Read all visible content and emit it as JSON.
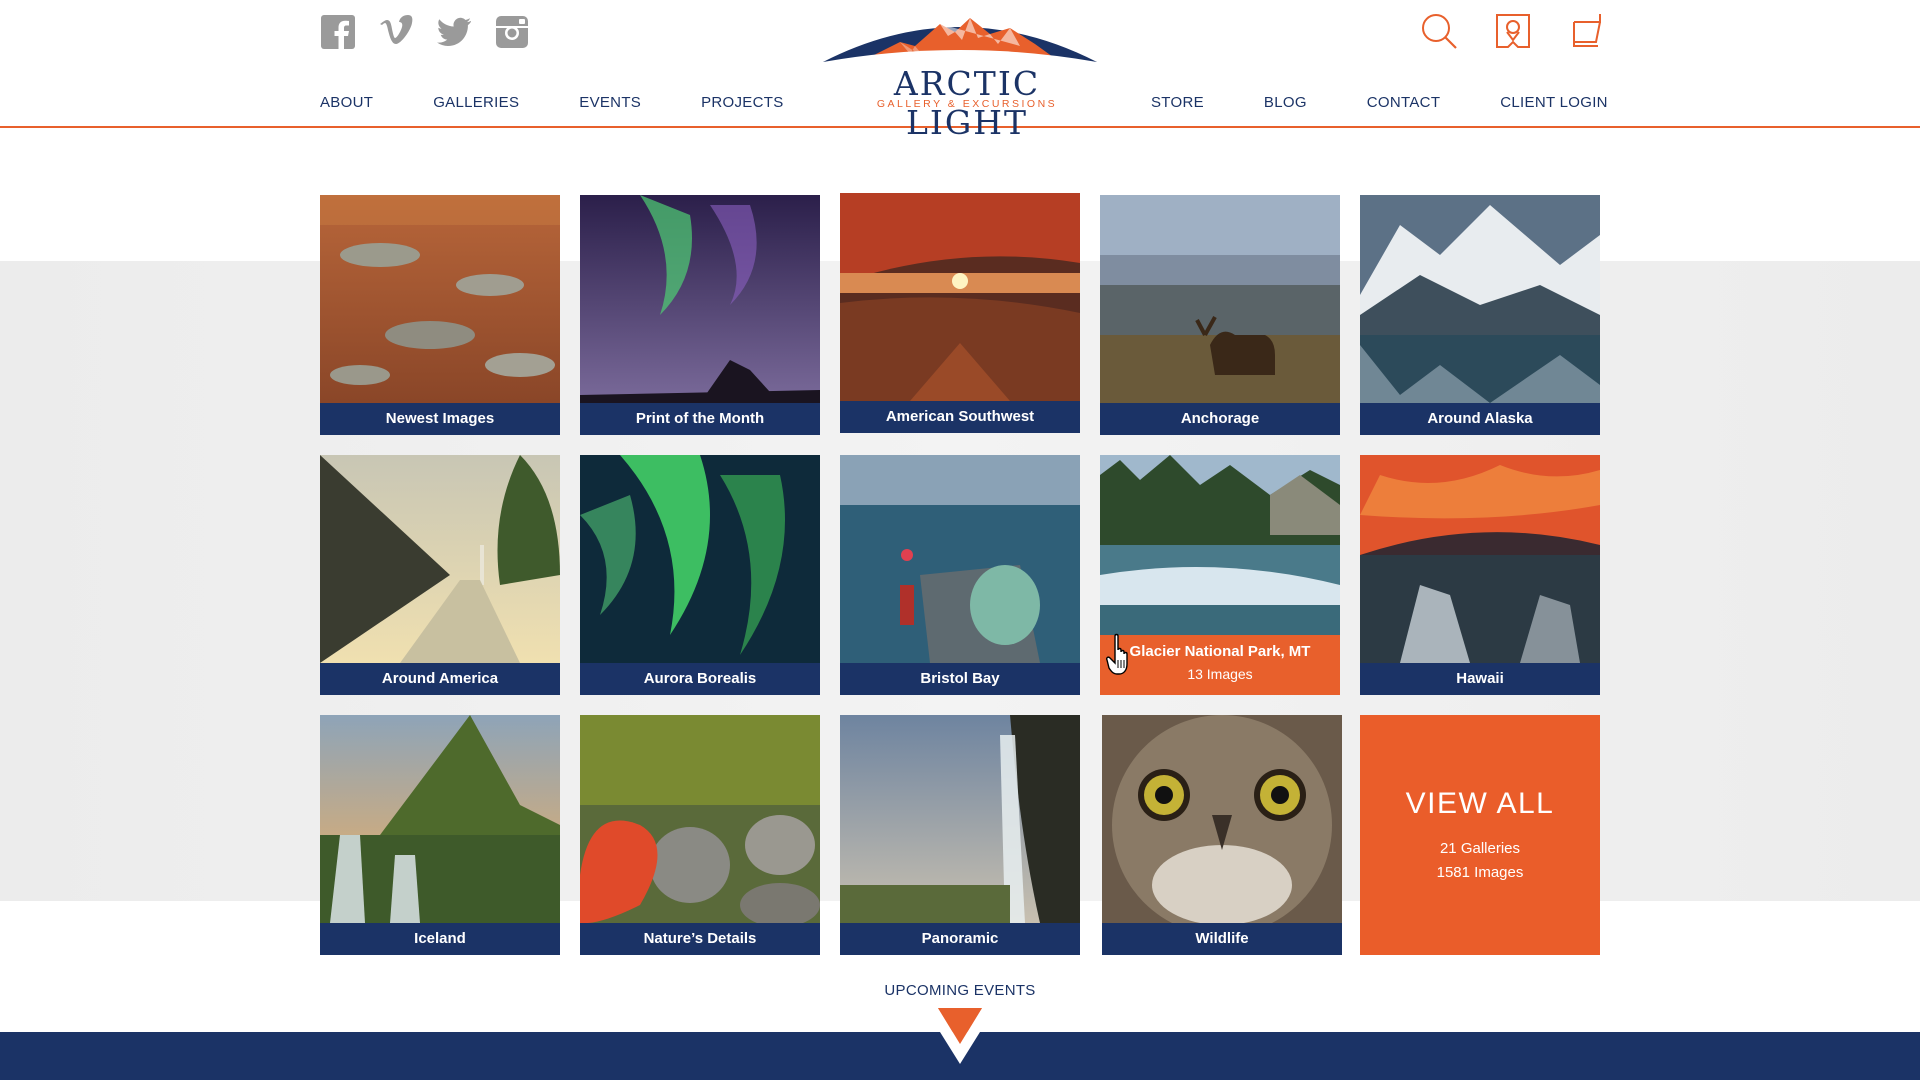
{
  "brand": {
    "name": "ARCTIC LIGHT",
    "tagline": "GALLERY & EXCURSIONS"
  },
  "colors": {
    "navy": "#1b3366",
    "orange": "#e8602c"
  },
  "social_icons": [
    "facebook-icon",
    "vimeo-icon",
    "twitter-icon",
    "instagram-icon"
  ],
  "utility_icons": [
    "search-icon",
    "location-icon",
    "cart-icon"
  ],
  "nav": {
    "left": [
      "ABOUT",
      "GALLERIES",
      "EVENTS",
      "PROJECTS"
    ],
    "right": [
      "STORE",
      "BLOG",
      "CONTACT",
      "CLIENT LOGIN"
    ]
  },
  "galleries": [
    {
      "title": "Newest Images"
    },
    {
      "title": "Print of the Month"
    },
    {
      "title": "American Southwest"
    },
    {
      "title": "Anchorage"
    },
    {
      "title": "Around Alaska"
    },
    {
      "title": "Around America"
    },
    {
      "title": "Aurora Borealis"
    },
    {
      "title": "Bristol Bay"
    },
    {
      "title": "Glacier National Park, MT",
      "count": "13 Images",
      "hovered": true
    },
    {
      "title": "Hawaii"
    },
    {
      "title": "Iceland"
    },
    {
      "title": "Nature’s Details"
    },
    {
      "title": "Panoramic"
    },
    {
      "title": "Wildlife"
    }
  ],
  "view_all": {
    "label": "VIEW ALL",
    "galleries": "21 Galleries",
    "images": "1581 Images"
  },
  "upcoming": {
    "label": "UPCOMING EVENTS"
  }
}
